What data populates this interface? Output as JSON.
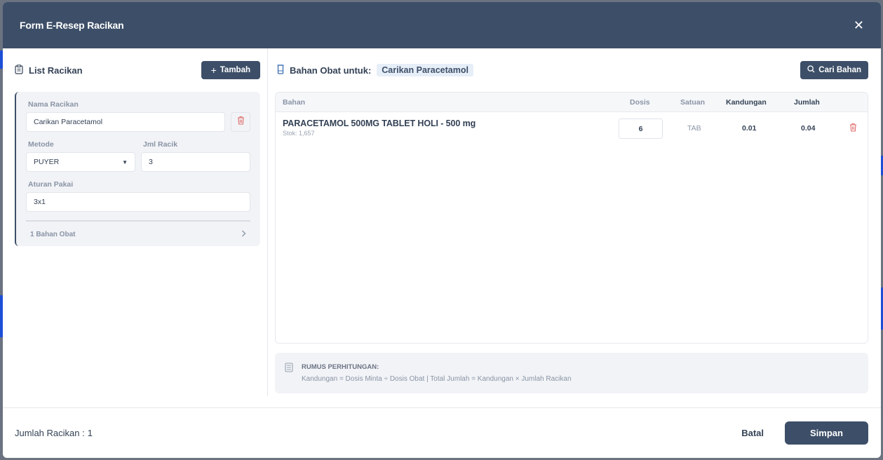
{
  "header": {
    "title": "Form E-Resep Racikan",
    "close_icon": "close-icon"
  },
  "left": {
    "title": "List Racikan",
    "add_button": "Tambah",
    "card": {
      "nama_label": "Nama Racikan",
      "nama_value": "Carikan Paracetamol",
      "metode_label": "Metode",
      "metode_value": "PUYER",
      "jml_label": "Jml Racik",
      "jml_value": "3",
      "aturan_label": "Aturan Pakai",
      "aturan_value": "3x1",
      "bahan_count": "1 Bahan Obat"
    }
  },
  "right": {
    "title": "Bahan Obat untuk:",
    "racikan_chip": "Carikan Paracetamol",
    "search_button": "Cari Bahan",
    "table": {
      "columns": [
        "Bahan",
        "Dosis",
        "Satuan",
        "Kandungan",
        "Jumlah"
      ],
      "rows": [
        {
          "name": "PARACETAMOL 500MG TABLET HOLI - 500 mg",
          "stok": "Stok: 1,657",
          "dosis": "6",
          "satuan": "TAB",
          "kandungan": "0.01",
          "jumlah": "0.04"
        }
      ]
    },
    "formula": {
      "title": "RUMUS PERHITUNGAN:",
      "text": "Kandungan = Dosis Minta ÷ Dosis Obat | Total Jumlah = Kandungan × Jumlah Racikan"
    }
  },
  "footer": {
    "count_label": "Jumlah Racikan :",
    "count_value": "1",
    "cancel_label": "Batal",
    "save_label": "Simpan"
  },
  "colors": {
    "primary": "#3d4f68",
    "danger": "#e06b6b",
    "chip_bg": "#e6eef8"
  }
}
